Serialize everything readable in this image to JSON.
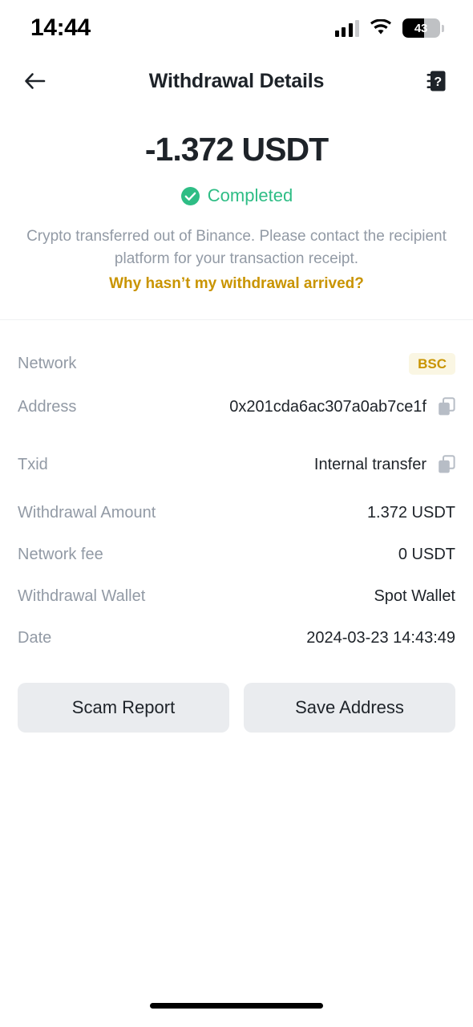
{
  "status_bar": {
    "time": "14:44",
    "battery_percent": "43",
    "signal_icon": "signal-bars-icon",
    "wifi_icon": "wifi-icon",
    "battery_icon": "battery-icon"
  },
  "header": {
    "title": "Withdrawal Details",
    "back_icon": "back-arrow-icon",
    "support_icon": "help-support-icon"
  },
  "hero": {
    "amount": "-1.372 USDT",
    "status": "Completed",
    "status_icon": "check-circle-icon",
    "status_color": "#2ebd85",
    "description": "Crypto transferred out of Binance. Please contact the recipient platform for your transaction receipt.",
    "help_link": "Why hasn’t my withdrawal arrived?",
    "link_color": "#c99400"
  },
  "details": {
    "network": {
      "label": "Network",
      "value": "BSC",
      "badge_bg": "#faf6e3",
      "badge_fg": "#c99400"
    },
    "address": {
      "label": "Address",
      "value": "0x201cda6ac307a0ab7ce1f",
      "copy_icon": "copy-icon"
    },
    "txid": {
      "label": "Txid",
      "value": "Internal transfer",
      "copy_icon": "copy-icon"
    },
    "withdrawal_amount": {
      "label": "Withdrawal Amount",
      "value": "1.372 USDT"
    },
    "network_fee": {
      "label": "Network fee",
      "value": "0 USDT"
    },
    "withdrawal_wallet": {
      "label": "Withdrawal Wallet",
      "value": "Spot Wallet"
    },
    "date": {
      "label": "Date",
      "value": "2024-03-23 14:43:49"
    }
  },
  "actions": {
    "scam_report": "Scam Report",
    "save_address": "Save Address"
  }
}
